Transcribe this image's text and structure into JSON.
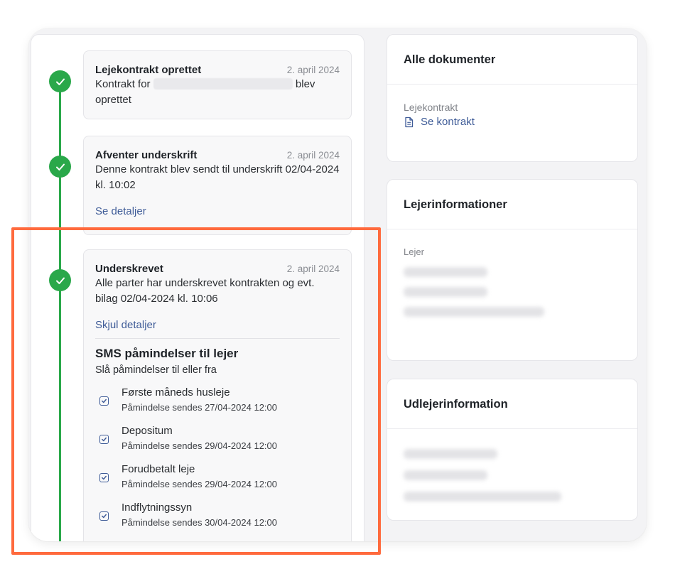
{
  "timeline": {
    "events": [
      {
        "title": "Lejekontrakt oprettet",
        "date": "2. april 2024",
        "desc_prefix": "Kontrakt for",
        "desc_suffix": "blev",
        "desc_line2": "oprettet"
      },
      {
        "title": "Afventer underskrift",
        "date": "2. april 2024",
        "desc": "Denne kontrakt blev sendt til underskrift 02/04-2024 kl. 10:02",
        "link": "Se detaljer"
      },
      {
        "title": "Underskrevet",
        "date": "2. april 2024",
        "desc": "Alle parter har underskrevet kontrakten og evt. bilag 02/04-2024 kl. 10:06",
        "link": "Skjul detaljer",
        "sms": {
          "title": "SMS påmindelser til lejer",
          "subtitle": "Slå påmindelser til eller fra",
          "reminders": [
            {
              "title": "Første måneds husleje",
              "subtitle": "Påmindelse sendes 27/04-2024 12:00",
              "checked": true
            },
            {
              "title": "Depositum",
              "subtitle": "Påmindelse sendes 29/04-2024 12:00",
              "checked": true
            },
            {
              "title": "Forudbetalt leje",
              "subtitle": "Påmindelse sendes 29/04-2024 12:00",
              "checked": true
            },
            {
              "title": "Indflytningssyn",
              "subtitle": "Påmindelse sendes 30/04-2024 12:00",
              "checked": true
            }
          ]
        }
      }
    ]
  },
  "documents": {
    "title": "Alle dokumenter",
    "label": "Lejekontrakt",
    "link": "Se kontrakt"
  },
  "tenant": {
    "title": "Lejerinformationer",
    "label": "Lejer"
  },
  "landlord": {
    "title": "Udlejerinformation"
  },
  "colors": {
    "accent_green": "#2aa84a",
    "link_blue": "#3e5b97",
    "highlight_orange": "#ff6a3d"
  }
}
